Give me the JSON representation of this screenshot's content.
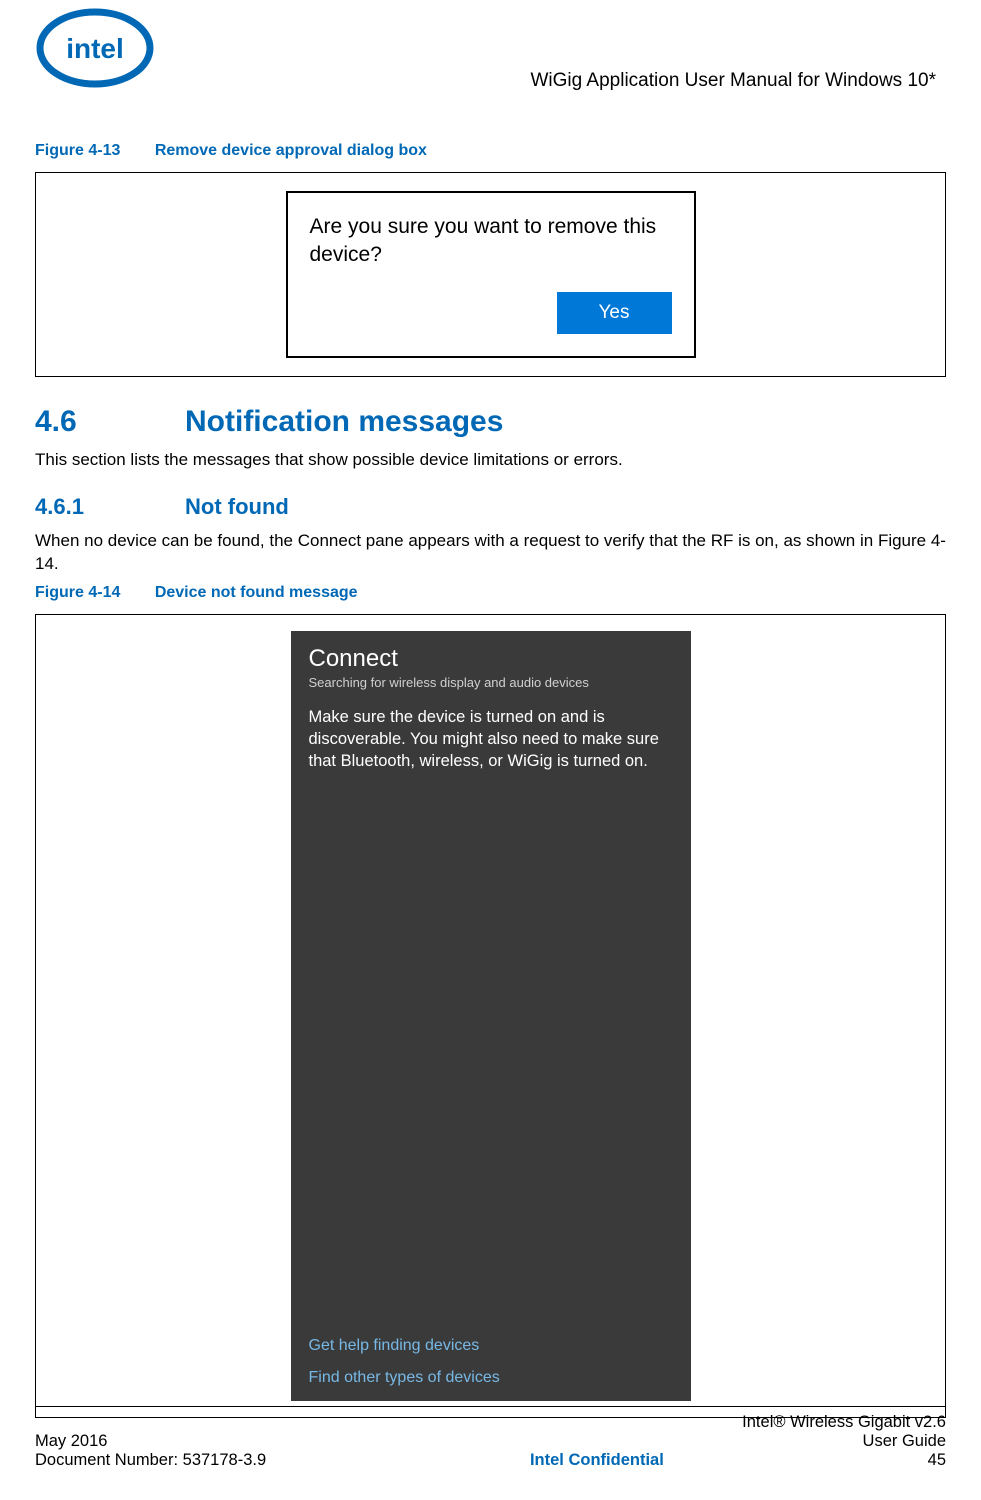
{
  "header": {
    "title": "WiGig Application User Manual for Windows 10*"
  },
  "figure13": {
    "label_num": "Figure 4-13",
    "label_title": "Remove device approval dialog box",
    "dialog_text": "Are you sure you want to remove this device?",
    "yes_button": "Yes"
  },
  "section46": {
    "num": "4.6",
    "title": "Notification messages",
    "intro": "This section lists the messages that show possible device limitations or errors."
  },
  "section461": {
    "num": "4.6.1",
    "title": "Not found",
    "body": "When no device can be found, the Connect pane appears with a request to verify that the RF is on, as shown in Figure 4-14."
  },
  "figure14": {
    "label_num": "Figure 4-14",
    "label_title": "Device not found message",
    "pane_title": "Connect",
    "pane_subtitle": "Searching for wireless display and audio devices",
    "pane_message": "Make sure the device is turned on and is discoverable. You might also need to make sure that Bluetooth, wireless, or WiGig is turned on.",
    "link1": "Get help finding devices",
    "link2": "Find other types of devices"
  },
  "footer": {
    "product_line": "Intel® Wireless Gigabit v2.6",
    "date": "May 2016",
    "guide": "User Guide",
    "docnum": "Document Number: 537178-3.9",
    "confidential": "Intel Confidential",
    "pagenum": "45"
  }
}
